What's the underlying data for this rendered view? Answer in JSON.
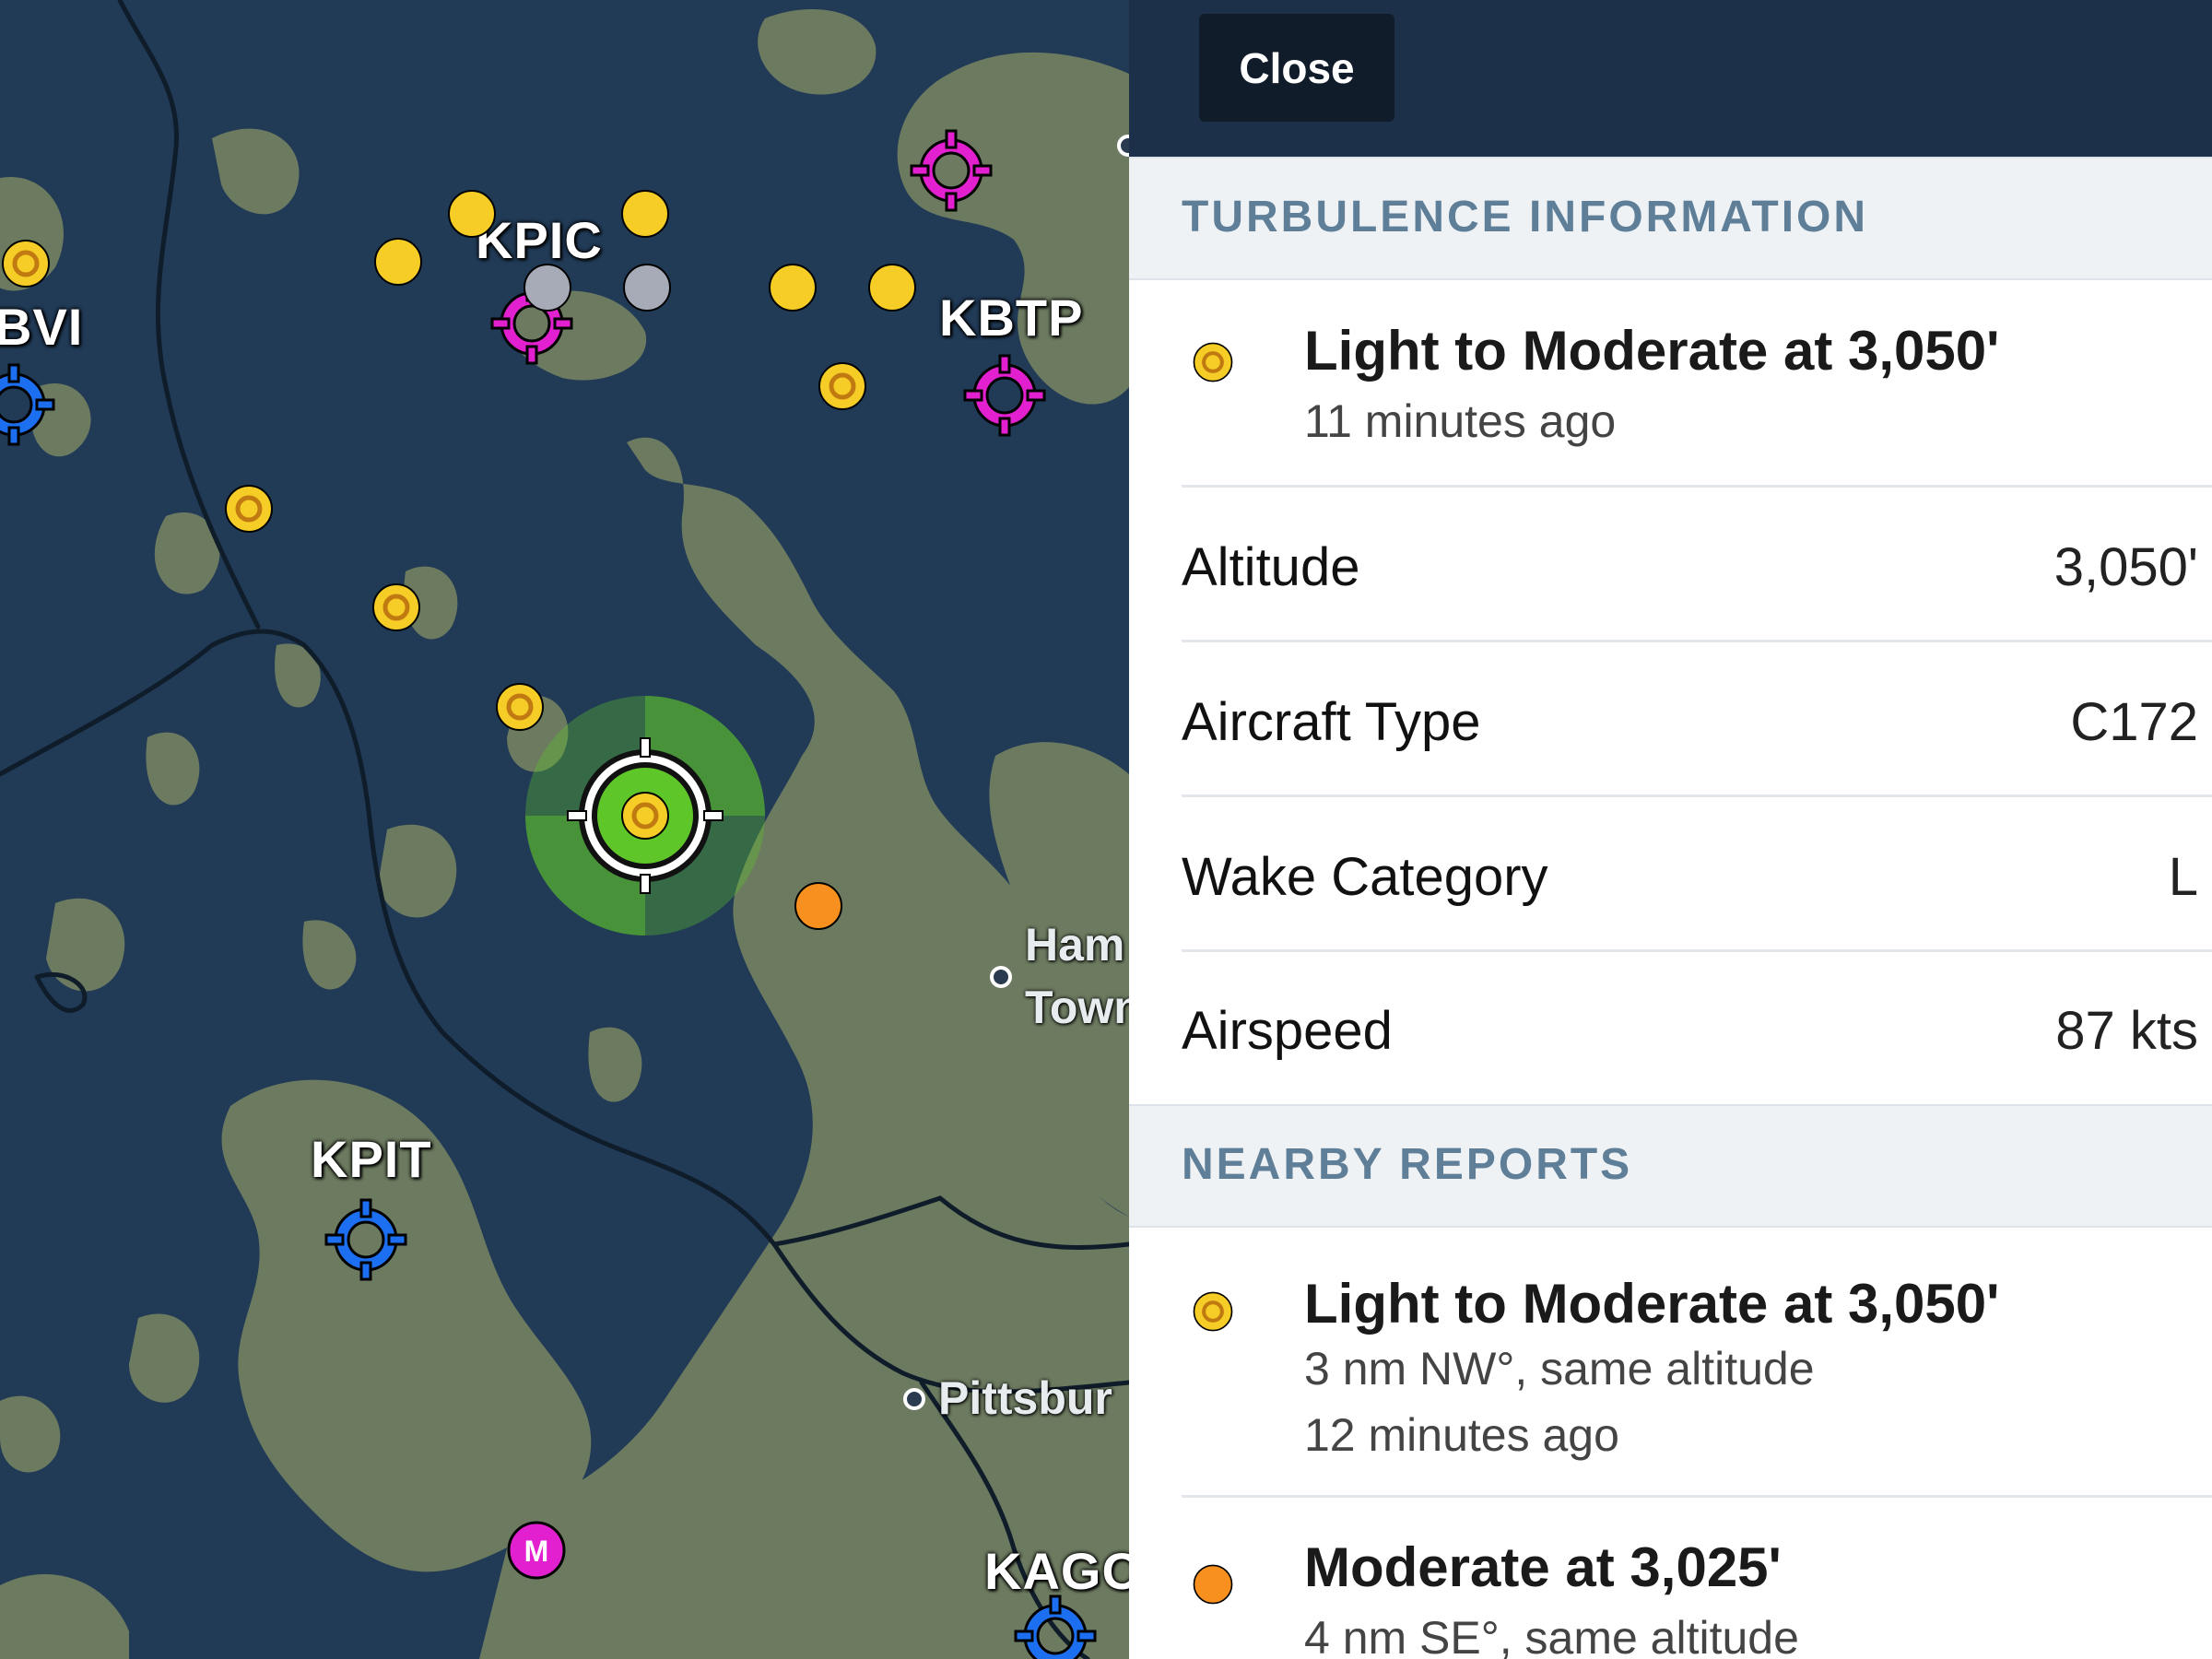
{
  "map": {
    "airports": {
      "kpic": "KPIC",
      "kbtp": "KBTP",
      "kpit": "KPIT",
      "kago": "KAGO",
      "bvi": "BVI"
    },
    "cities": {
      "hampton": "Ham",
      "hampton_line2": "Town",
      "pittsburgh": "Pittsbur"
    },
    "mil_badge": "M",
    "colors": {
      "light_moderate": "#f6cd26",
      "moderate": "#f7901e",
      "unknown": "#a7abb8",
      "selected": "#5fc62a",
      "airport_towered": "#e320d0",
      "airport_untowered": "#1d6ff2",
      "terrain": "#6c7a60",
      "water": "#213a56"
    }
  },
  "panel": {
    "close_label": "Close",
    "turbulence_section": "TURBULENCE INFORMATION",
    "selected_report": {
      "title": "Light to Moderate at 3,050'",
      "age": "11 minutes ago",
      "severity_color": "#f6cd26"
    },
    "details": [
      {
        "label": "Altitude",
        "value": "3,050'"
      },
      {
        "label": "Aircraft Type",
        "value": "C172"
      },
      {
        "label": "Wake Category",
        "value": "L"
      },
      {
        "label": "Airspeed",
        "value": "87 kts"
      }
    ],
    "nearby_section": "NEARBY REPORTS",
    "nearby": [
      {
        "title": "Light to Moderate at 3,050'",
        "distance": "3 nm NW°, same altitude",
        "age": "12 minutes ago",
        "severity_color": "#f6cd26"
      },
      {
        "title": "Moderate at 3,025'",
        "distance": "4 nm SE°, same altitude",
        "severity_color": "#f7901e"
      }
    ]
  }
}
